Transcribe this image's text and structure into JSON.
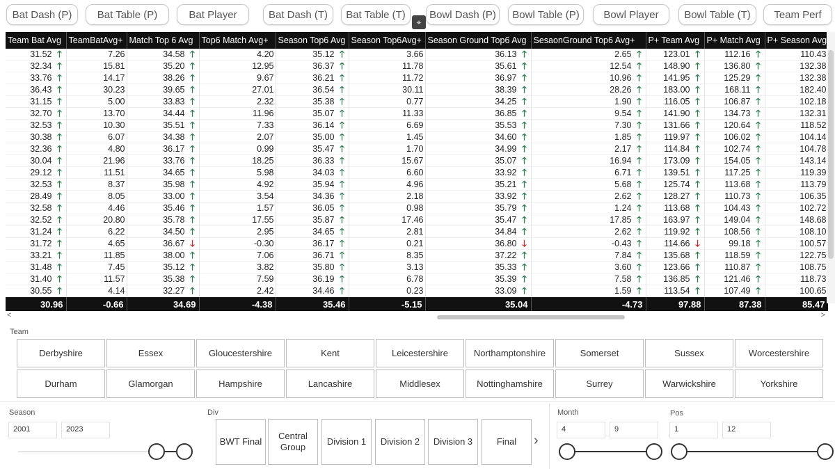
{
  "nav": {
    "items": [
      "Bat Dash (P)",
      "Bat Table (P)",
      "Bat Player",
      "Bat Dash (T)",
      "Bat Table (T)",
      "Bowl Dash (P)",
      "Bowl Table (P)",
      "Bowl Player",
      "Bowl Table (T)",
      "Team Perf"
    ]
  },
  "table": {
    "headers": [
      "Team Bat Avg",
      "TeamBatAvg+",
      "Match Top 6 Avg",
      "Top6 Match Avg+",
      "Season Top6 Avg",
      "Season Top6Avg+",
      "Season Ground Top6 Avg",
      "SesaonGround Top6 Avg+",
      "P+ Team Avg",
      "P+ Match Avg",
      "P+ Season Avg"
    ],
    "rows": [
      [
        [
          "31.52",
          "up"
        ],
        [
          "7.26",
          null
        ],
        [
          "34.58",
          "up"
        ],
        [
          "4.20",
          null
        ],
        [
          "35.12",
          "up"
        ],
        [
          "3.66",
          null
        ],
        [
          "36.13",
          "up"
        ],
        [
          "2.65",
          "up"
        ],
        [
          "123.01",
          "up"
        ],
        [
          "112.16",
          "up"
        ],
        [
          "110.43",
          null
        ]
      ],
      [
        [
          "32.34",
          "up"
        ],
        [
          "15.81",
          null
        ],
        [
          "35.20",
          "up"
        ],
        [
          "12.95",
          null
        ],
        [
          "36.37",
          "up"
        ],
        [
          "11.78",
          null
        ],
        [
          "35.61",
          "up"
        ],
        [
          "12.54",
          "up"
        ],
        [
          "148.90",
          "up"
        ],
        [
          "136.80",
          "up"
        ],
        [
          "132.38",
          null
        ]
      ],
      [
        [
          "33.76",
          "up"
        ],
        [
          "14.17",
          null
        ],
        [
          "38.26",
          "up"
        ],
        [
          "9.67",
          null
        ],
        [
          "36.21",
          "up"
        ],
        [
          "11.72",
          null
        ],
        [
          "36.97",
          "up"
        ],
        [
          "10.96",
          "up"
        ],
        [
          "141.95",
          "up"
        ],
        [
          "125.29",
          "up"
        ],
        [
          "132.38",
          null
        ]
      ],
      [
        [
          "36.43",
          "up"
        ],
        [
          "30.23",
          null
        ],
        [
          "39.65",
          "up"
        ],
        [
          "27.01",
          null
        ],
        [
          "36.54",
          "up"
        ],
        [
          "30.11",
          null
        ],
        [
          "38.39",
          "up"
        ],
        [
          "28.26",
          "up"
        ],
        [
          "183.00",
          "up"
        ],
        [
          "168.11",
          "up"
        ],
        [
          "182.40",
          null
        ]
      ],
      [
        [
          "31.15",
          "up"
        ],
        [
          "5.00",
          null
        ],
        [
          "33.83",
          "up"
        ],
        [
          "2.32",
          null
        ],
        [
          "35.38",
          "up"
        ],
        [
          "0.77",
          null
        ],
        [
          "34.25",
          "up"
        ],
        [
          "1.90",
          "up"
        ],
        [
          "116.05",
          "up"
        ],
        [
          "106.87",
          "up"
        ],
        [
          "102.18",
          null
        ]
      ],
      [
        [
          "32.70",
          "up"
        ],
        [
          "13.70",
          null
        ],
        [
          "34.44",
          "up"
        ],
        [
          "11.96",
          null
        ],
        [
          "35.07",
          "up"
        ],
        [
          "11.33",
          null
        ],
        [
          "36.85",
          "up"
        ],
        [
          "9.54",
          "up"
        ],
        [
          "141.90",
          "up"
        ],
        [
          "134.73",
          "up"
        ],
        [
          "132.31",
          null
        ]
      ],
      [
        [
          "32.53",
          "up"
        ],
        [
          "10.30",
          null
        ],
        [
          "35.51",
          "up"
        ],
        [
          "7.33",
          null
        ],
        [
          "36.14",
          "up"
        ],
        [
          "6.69",
          null
        ],
        [
          "35.53",
          "up"
        ],
        [
          "7.30",
          "up"
        ],
        [
          "131.66",
          "up"
        ],
        [
          "120.64",
          "up"
        ],
        [
          "118.52",
          null
        ]
      ],
      [
        [
          "30.38",
          "up"
        ],
        [
          "6.07",
          null
        ],
        [
          "34.38",
          "up"
        ],
        [
          "2.07",
          null
        ],
        [
          "35.00",
          "up"
        ],
        [
          "1.45",
          null
        ],
        [
          "34.60",
          "up"
        ],
        [
          "1.85",
          "up"
        ],
        [
          "119.97",
          "up"
        ],
        [
          "106.02",
          "up"
        ],
        [
          "104.14",
          null
        ]
      ],
      [
        [
          "32.36",
          "up"
        ],
        [
          "4.80",
          null
        ],
        [
          "36.17",
          "up"
        ],
        [
          "0.99",
          null
        ],
        [
          "35.47",
          "up"
        ],
        [
          "1.70",
          null
        ],
        [
          "34.99",
          "up"
        ],
        [
          "2.17",
          "up"
        ],
        [
          "114.84",
          "up"
        ],
        [
          "102.74",
          "up"
        ],
        [
          "104.78",
          null
        ]
      ],
      [
        [
          "30.04",
          "up"
        ],
        [
          "21.96",
          null
        ],
        [
          "33.76",
          "up"
        ],
        [
          "18.25",
          null
        ],
        [
          "36.33",
          "up"
        ],
        [
          "15.67",
          null
        ],
        [
          "35.07",
          "up"
        ],
        [
          "16.94",
          "up"
        ],
        [
          "173.09",
          "up"
        ],
        [
          "154.05",
          "up"
        ],
        [
          "143.14",
          null
        ]
      ],
      [
        [
          "29.12",
          "up"
        ],
        [
          "11.51",
          null
        ],
        [
          "34.65",
          "up"
        ],
        [
          "5.98",
          null
        ],
        [
          "34.03",
          "up"
        ],
        [
          "6.60",
          null
        ],
        [
          "33.92",
          "up"
        ],
        [
          "6.71",
          "up"
        ],
        [
          "139.51",
          "up"
        ],
        [
          "117.25",
          "up"
        ],
        [
          "119.39",
          null
        ]
      ],
      [
        [
          "32.53",
          "up"
        ],
        [
          "8.37",
          null
        ],
        [
          "35.98",
          "up"
        ],
        [
          "4.92",
          null
        ],
        [
          "35.94",
          "up"
        ],
        [
          "4.96",
          null
        ],
        [
          "35.21",
          "up"
        ],
        [
          "5.68",
          "up"
        ],
        [
          "125.74",
          "up"
        ],
        [
          "113.68",
          "up"
        ],
        [
          "113.79",
          null
        ]
      ],
      [
        [
          "28.49",
          "up"
        ],
        [
          "8.05",
          null
        ],
        [
          "33.00",
          "up"
        ],
        [
          "3.54",
          null
        ],
        [
          "34.36",
          "up"
        ],
        [
          "2.18",
          null
        ],
        [
          "33.92",
          "up"
        ],
        [
          "2.62",
          "up"
        ],
        [
          "128.27",
          "up"
        ],
        [
          "110.73",
          "up"
        ],
        [
          "106.35",
          null
        ]
      ],
      [
        [
          "32.58",
          "up"
        ],
        [
          "4.46",
          null
        ],
        [
          "35.46",
          "up"
        ],
        [
          "1.57",
          null
        ],
        [
          "36.05",
          "up"
        ],
        [
          "0.98",
          null
        ],
        [
          "35.79",
          "up"
        ],
        [
          "1.24",
          "up"
        ],
        [
          "113.68",
          "up"
        ],
        [
          "104.43",
          "up"
        ],
        [
          "102.72",
          null
        ]
      ],
      [
        [
          "32.52",
          "up"
        ],
        [
          "20.80",
          null
        ],
        [
          "35.78",
          "up"
        ],
        [
          "17.55",
          null
        ],
        [
          "35.87",
          "up"
        ],
        [
          "17.46",
          null
        ],
        [
          "35.47",
          "up"
        ],
        [
          "17.85",
          "up"
        ],
        [
          "163.97",
          "up"
        ],
        [
          "149.04",
          "up"
        ],
        [
          "148.68",
          null
        ]
      ],
      [
        [
          "31.24",
          "up"
        ],
        [
          "6.22",
          null
        ],
        [
          "34.50",
          "up"
        ],
        [
          "2.95",
          null
        ],
        [
          "34.65",
          "up"
        ],
        [
          "2.81",
          null
        ],
        [
          "34.84",
          "up"
        ],
        [
          "2.62",
          "up"
        ],
        [
          "119.92",
          "up"
        ],
        [
          "108.56",
          "up"
        ],
        [
          "108.10",
          null
        ]
      ],
      [
        [
          "31.72",
          "up"
        ],
        [
          "4.65",
          null
        ],
        [
          "36.67",
          "down"
        ],
        [
          "-0.30",
          null
        ],
        [
          "36.17",
          "up"
        ],
        [
          "0.21",
          null
        ],
        [
          "36.80",
          "down"
        ],
        [
          "-0.43",
          "up"
        ],
        [
          "114.66",
          "down"
        ],
        [
          "99.18",
          "up"
        ],
        [
          "100.57",
          null
        ]
      ],
      [
        [
          "33.21",
          "up"
        ],
        [
          "11.85",
          null
        ],
        [
          "38.00",
          "up"
        ],
        [
          "7.06",
          null
        ],
        [
          "36.71",
          "up"
        ],
        [
          "8.35",
          null
        ],
        [
          "37.22",
          "up"
        ],
        [
          "7.84",
          "up"
        ],
        [
          "135.68",
          "up"
        ],
        [
          "118.59",
          "up"
        ],
        [
          "122.75",
          null
        ]
      ],
      [
        [
          "31.48",
          "up"
        ],
        [
          "7.45",
          null
        ],
        [
          "35.12",
          "up"
        ],
        [
          "3.82",
          null
        ],
        [
          "35.80",
          "up"
        ],
        [
          "3.13",
          null
        ],
        [
          "35.33",
          "up"
        ],
        [
          "3.60",
          "up"
        ],
        [
          "123.66",
          "up"
        ],
        [
          "110.87",
          "up"
        ],
        [
          "108.75",
          null
        ]
      ],
      [
        [
          "31.40",
          "up"
        ],
        [
          "11.57",
          null
        ],
        [
          "35.38",
          "up"
        ],
        [
          "7.59",
          null
        ],
        [
          "36.19",
          "up"
        ],
        [
          "6.78",
          null
        ],
        [
          "35.39",
          "up"
        ],
        [
          "7.58",
          "up"
        ],
        [
          "136.85",
          "up"
        ],
        [
          "121.46",
          "up"
        ],
        [
          "118.73",
          null
        ]
      ],
      [
        [
          "30.55",
          "up"
        ],
        [
          "4.14",
          null
        ],
        [
          "32.27",
          "up"
        ],
        [
          "2.42",
          null
        ],
        [
          "34.46",
          "up"
        ],
        [
          "0.23",
          null
        ],
        [
          "33.09",
          "up"
        ],
        [
          "1.59",
          "up"
        ],
        [
          "113.54",
          "up"
        ],
        [
          "107.49",
          "up"
        ],
        [
          "100.65",
          null
        ]
      ]
    ],
    "totals": [
      "30.96",
      "-0.66",
      "34.69",
      "-4.38",
      "35.46",
      "-5.15",
      "35.04",
      "-4.73",
      "97.88",
      "87.38",
      "85.47"
    ]
  },
  "team_slicer": {
    "label": "Team",
    "row1": [
      "Derbyshire",
      "Essex",
      "Gloucestershire",
      "Kent",
      "Leicestershire",
      "Northamptonshire",
      "Somerset",
      "Sussex",
      "Worcestershire"
    ],
    "row2": [
      "Durham",
      "Glamorgan",
      "Hampshire",
      "Lancashire",
      "Middlesex",
      "Nottinghamshire",
      "Surrey",
      "Warwickshire",
      "Yorkshire"
    ]
  },
  "season": {
    "label": "Season",
    "from": "2001",
    "to": "2023"
  },
  "div": {
    "label": "Div",
    "items": [
      "BWT Final",
      "Central Group",
      "Division 1",
      "Division 2",
      "Division 3",
      "Final"
    ],
    "next_icon": "chevron-right-icon"
  },
  "month": {
    "label": "Month",
    "from": "4",
    "to": "9"
  },
  "pos": {
    "label": "Pos",
    "from": "1",
    "to": "12"
  },
  "colors": {
    "header_bg": "#111111",
    "up_arrow": "#2e7d4f",
    "down_arrow": "#cc2a2a"
  }
}
